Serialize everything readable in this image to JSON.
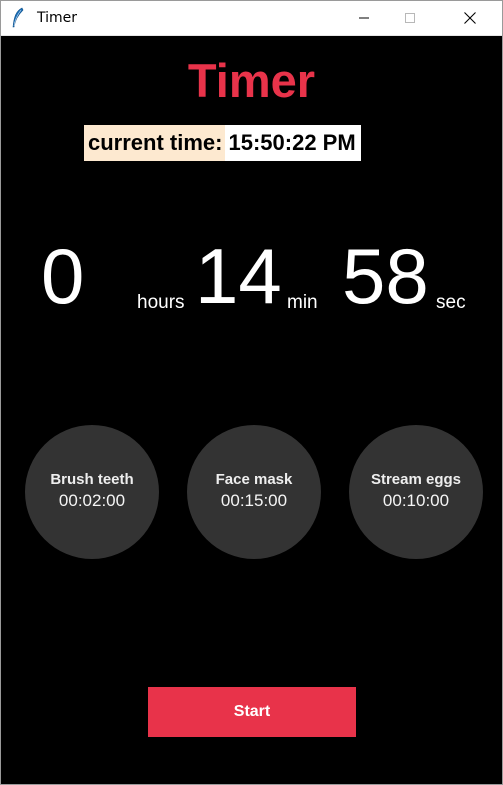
{
  "window": {
    "title": "Timer",
    "icon": "feather-icon"
  },
  "app": {
    "heading": "Timer",
    "current_time": {
      "label": "current time:",
      "value": "15:50:22 PM"
    },
    "countdown": {
      "hours": "0",
      "hours_unit": "hours",
      "minutes": "14",
      "minutes_unit": "min",
      "seconds": "58",
      "seconds_unit": "sec"
    },
    "presets": [
      {
        "label": "Brush teeth",
        "time": "00:02:00"
      },
      {
        "label": "Face mask",
        "time": "00:15:00"
      },
      {
        "label": "Stream eggs",
        "time": "00:10:00"
      }
    ],
    "start_label": "Start"
  },
  "colors": {
    "accent": "#e8334a",
    "background": "#000000",
    "preset_circle": "#333333",
    "label_bg": "#fde9d0"
  }
}
